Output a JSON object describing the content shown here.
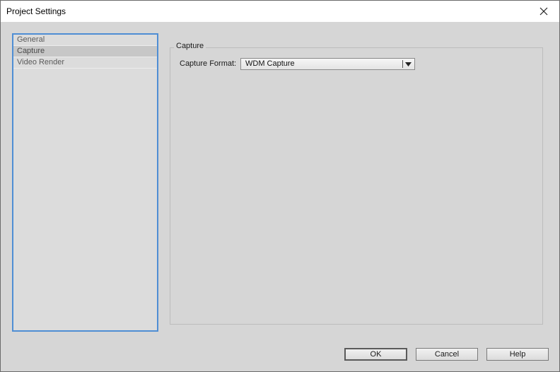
{
  "window": {
    "title": "Project Settings",
    "close_icon": "close-icon"
  },
  "sidebar": {
    "items": [
      {
        "label": "General",
        "selected": false
      },
      {
        "label": "Capture",
        "selected": true
      },
      {
        "label": "Video Render",
        "selected": false
      }
    ]
  },
  "capture_group": {
    "legend": "Capture",
    "format_label": "Capture Format:",
    "format_value": "WDM Capture",
    "dropdown_icon": "chevron-down-icon"
  },
  "buttons": {
    "ok": "OK",
    "cancel": "Cancel",
    "help": "Help"
  },
  "colors": {
    "selection_border": "#4f8ed4",
    "dialog_background": "#d6d6d6"
  }
}
